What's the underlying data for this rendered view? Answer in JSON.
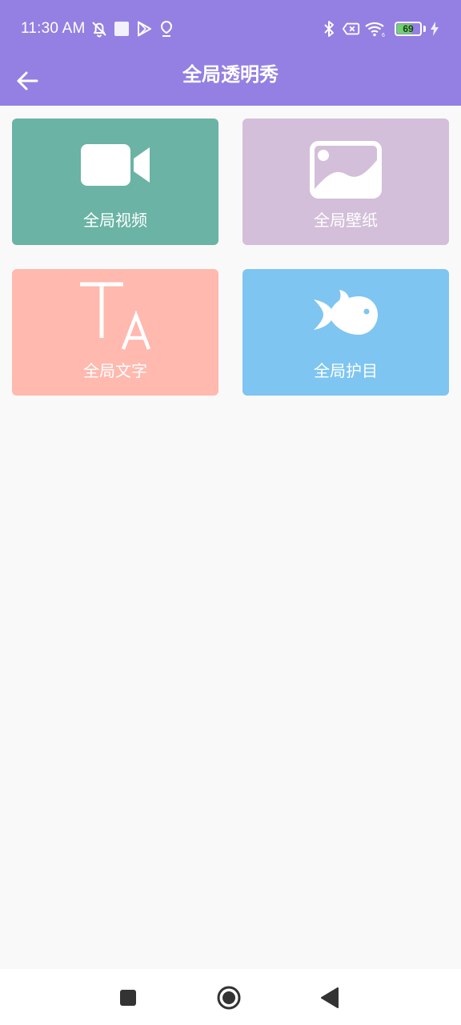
{
  "colors": {
    "header": "#9480e2",
    "video_tile": "#6ab3a5",
    "wallpaper_tile": "#d3bfd9",
    "text_tile": "#ffb9ae",
    "eye_tile": "#7ec5f1",
    "nav_icon": "#333333"
  },
  "status_bar": {
    "time": "11:30 AM",
    "battery_level": "69",
    "left_icons": [
      "mute-icon",
      "square-notification-icon",
      "play-store-icon",
      "location-pin-icon"
    ],
    "right_icons": [
      "bluetooth-icon",
      "no-sim-icon",
      "wifi-icon",
      "battery-icon",
      "charging-icon"
    ]
  },
  "app_bar": {
    "title": "全局透明秀",
    "back_icon": "arrow-left-icon"
  },
  "tiles": [
    {
      "label": "全局视频",
      "icon": "video-camera-icon"
    },
    {
      "label": "全局壁纸",
      "icon": "image-icon"
    },
    {
      "label": "全局文字",
      "icon": "text-size-icon"
    },
    {
      "label": "全局护目",
      "icon": "fish-icon"
    }
  ],
  "nav_bar": {
    "icons": [
      "recents-square-icon",
      "home-circle-icon",
      "back-triangle-icon"
    ]
  }
}
